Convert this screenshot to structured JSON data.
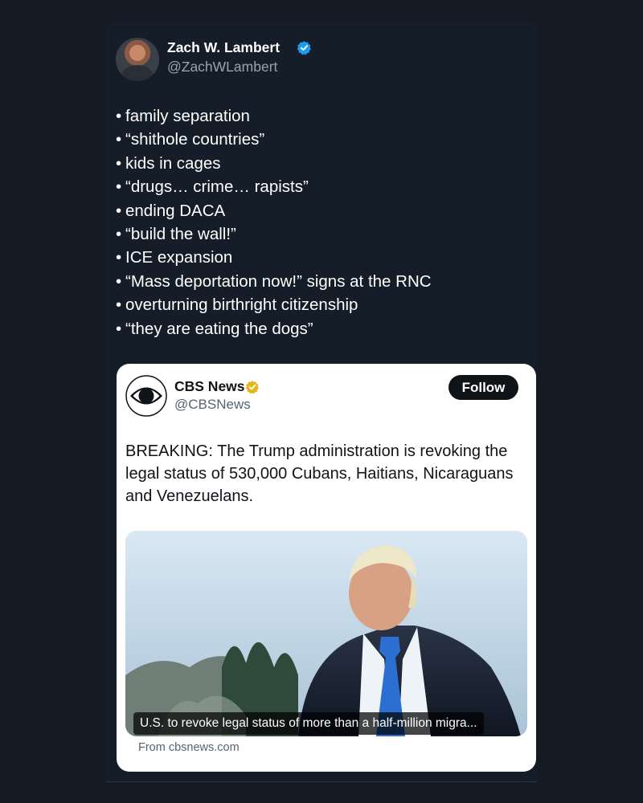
{
  "post": {
    "author": {
      "name": "Zach W. Lambert",
      "handle": "@ZachWLambert"
    },
    "bullet_symbol": "•",
    "bullets": [
      "family separation",
      "“shithole countries”",
      "kids in cages",
      "“drugs… crime… rapists”",
      "ending DACA",
      "“build the wall!”",
      "ICE expansion",
      "“Mass deportation now!” signs at the RNC",
      "overturning birthright citizenship",
      "“they are eating the dogs”"
    ]
  },
  "quoted_post": {
    "author": {
      "name": "CBS News",
      "handle": "@CBSNews"
    },
    "follow_label": "Follow",
    "text": "BREAKING: The Trump administration is revoking the legal status of 530,000 Cubans, Haitians, Nicaraguans and Venezuelans.",
    "link_card": {
      "headline": "U.S. to revoke legal status of more than a half-million migra...",
      "source": "From cbsnews.com"
    }
  },
  "colors": {
    "background": "#141b25",
    "verified_blue": "#1d9bf0",
    "verified_gold": "#e2b719",
    "follow_button": "#0f1419"
  },
  "icons": {
    "verified": "verified-badge-icon",
    "cbs_logo": "cbs-eye-logo"
  }
}
